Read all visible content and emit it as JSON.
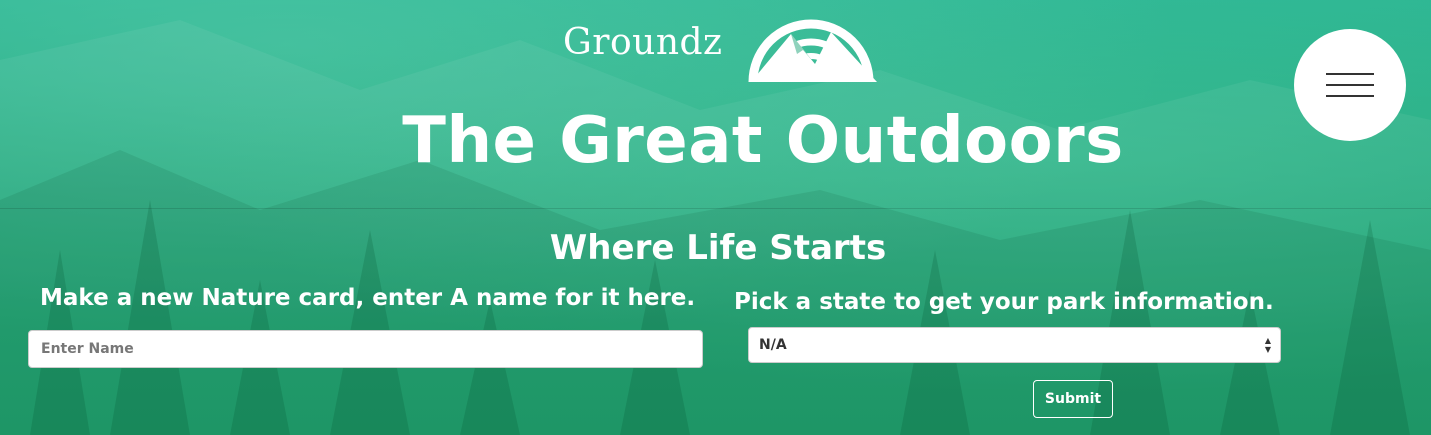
{
  "brand": {
    "name": "Groundz",
    "logo_icon": "mountain-sun-icon"
  },
  "menu": {
    "icon": "hamburger-menu-icon"
  },
  "hero": {
    "title": "The Great Outdoors",
    "subtitle": "Where Life Starts"
  },
  "card_form": {
    "label": "Make a new Nature card, enter A name for it here.",
    "name_placeholder": "Enter Name",
    "name_value": ""
  },
  "state_form": {
    "label": "Pick a state to get your park information.",
    "selected_state": "N/A",
    "submit_label": "Submit"
  },
  "colors": {
    "overlay_green": "#1fa679",
    "text": "#ffffff",
    "menu_bg": "#ffffff"
  }
}
